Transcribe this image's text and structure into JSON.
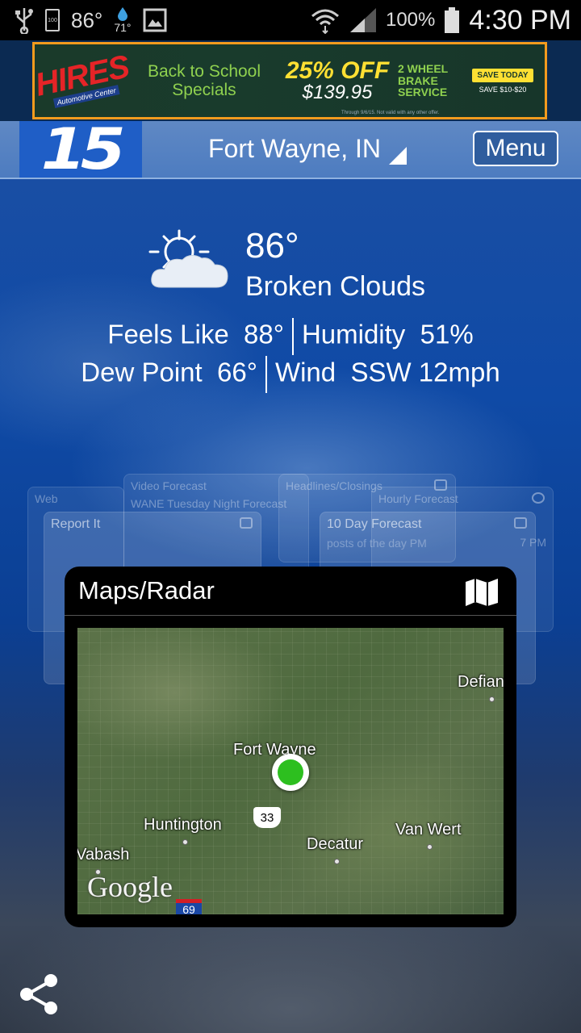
{
  "status_bar": {
    "temp": "86°",
    "dew_temp": "71°",
    "battery_icon_text": "100",
    "battery_pct": "100%",
    "time": "4:30 PM"
  },
  "ad": {
    "brand": "HIRES",
    "brand_sub": "Automotive Center",
    "headline": "Back to School Specials",
    "discount": "25% OFF",
    "price": "$139.95",
    "service": "2 WHEEL BRAKE SERVICE",
    "cta": "SAVE TODAY",
    "save_text": "SAVE $10-$20",
    "disclaimer": "Through 9/6/15. Not valid with any other offer."
  },
  "header": {
    "logo": "15",
    "location": "Fort Wayne, IN",
    "menu_label": "Menu"
  },
  "weather": {
    "temperature": "86°",
    "condition": "Broken Clouds",
    "feels_like_label": "Feels Like",
    "feels_like": "88°",
    "humidity_label": "Humidity",
    "humidity": "51%",
    "dew_point_label": "Dew Point",
    "dew_point": "66°",
    "wind_label": "Wind",
    "wind": "SSW 12mph",
    "icon": "sun-behind-cloud-icon"
  },
  "background_cards": [
    {
      "title": "Web"
    },
    {
      "title": "Video Forecast",
      "subtitle": "WANE Tuesday Night Forecast"
    },
    {
      "title": "Headlines/Closings"
    },
    {
      "title": "Hourly Forecast",
      "subtitle": "7 PM"
    },
    {
      "title": "Report It"
    },
    {
      "title": "10 Day Forecast",
      "subtitle": "posts of the day PM"
    }
  ],
  "maps_card": {
    "title": "Maps/Radar",
    "icon": "map-icon",
    "cities": {
      "fort_wayne": "Fort Wayne",
      "defiance": "Defian",
      "huntington": "Huntington",
      "decatur": "Decatur",
      "van_wert": "Van Wert",
      "wabash": "Vabash"
    },
    "route_33": "33",
    "route_69": "69",
    "attribution": "Google"
  },
  "colors": {
    "accent_green": "#2dbf1f",
    "ad_border": "#f39b1e",
    "header_blue": "#4d7cc0"
  }
}
